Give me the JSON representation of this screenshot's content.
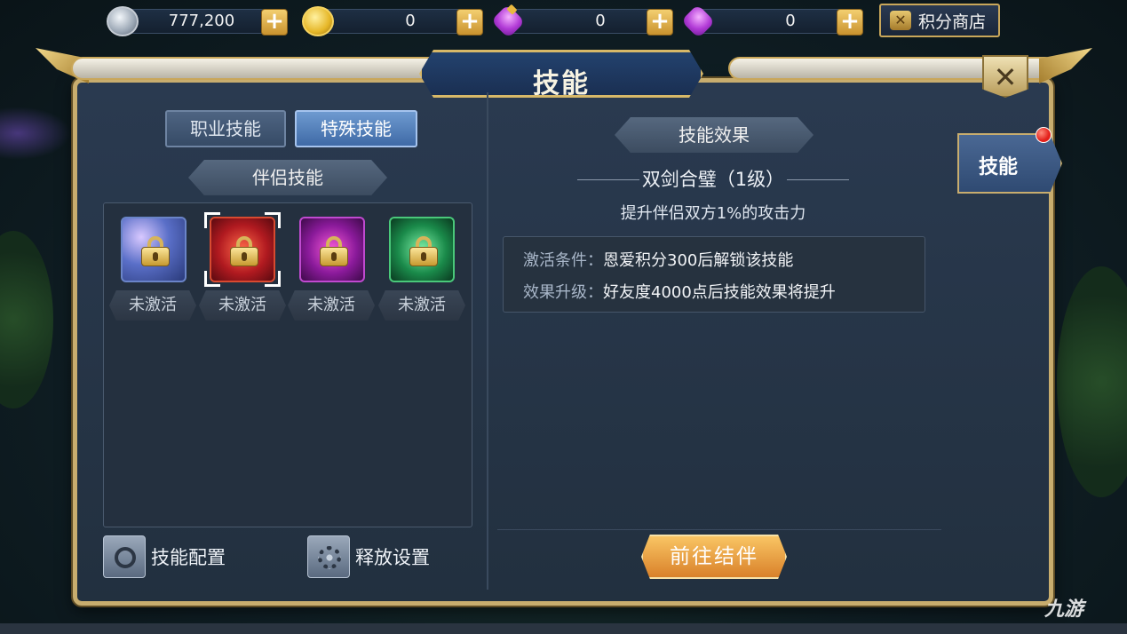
{
  "currencies": [
    {
      "icon": "silver-coin-icon",
      "value": "777,200"
    },
    {
      "icon": "gold-coin-icon",
      "value": "0"
    },
    {
      "icon": "locked-gem-icon",
      "value": "0"
    },
    {
      "icon": "gem-icon",
      "value": "0"
    }
  ],
  "plus_label": "+",
  "shop": {
    "label": "积分商店",
    "icon": "shop-icon"
  },
  "window": {
    "title": "技能",
    "close": "✕"
  },
  "tabs": {
    "job": "职业技能",
    "special": "特殊技能"
  },
  "section": {
    "companion": "伴侣技能",
    "effect": "技能效果"
  },
  "skills": [
    {
      "state": "未激活"
    },
    {
      "state": "未激活"
    },
    {
      "state": "未激活"
    },
    {
      "state": "未激活"
    }
  ],
  "detail": {
    "name": "双剑合璧（1级）",
    "description": "提升伴侣双方1%的攻击力",
    "condition_key": "激活条件：",
    "condition_value": "恩爱积分300后解锁该技能",
    "upgrade_key": "效果升级：",
    "upgrade_value": "好友度4000点后技能效果将提升"
  },
  "buttons": {
    "config": "技能配置",
    "release": "释放设置",
    "goto": "前往结伴"
  },
  "side_tab": {
    "label": "技能"
  },
  "watermark": "九游",
  "colors": {
    "accent_gold": "#c8ad6e",
    "orange_button": "#d9812a",
    "tab_active": "#3f6aa6",
    "notify_red": "#e3201a"
  }
}
